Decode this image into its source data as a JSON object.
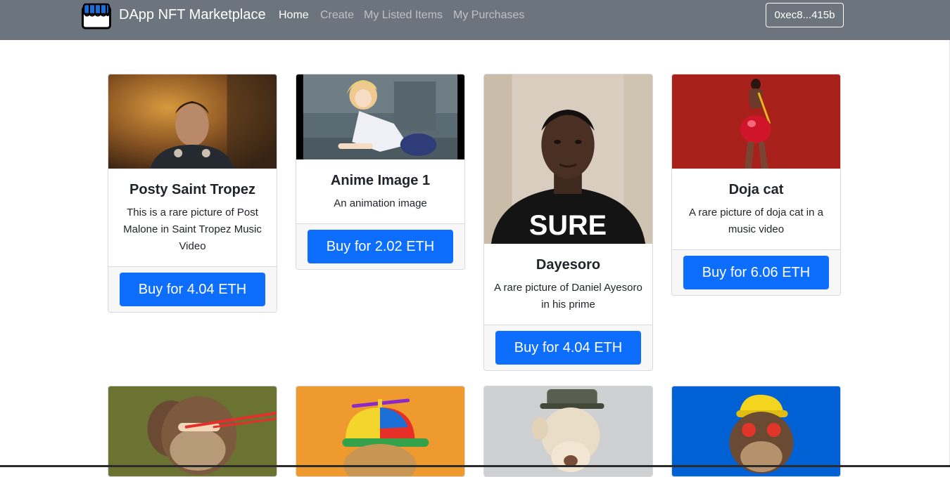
{
  "app": {
    "brand": "DApp NFT Marketplace",
    "nav": [
      {
        "label": "Home",
        "active": true
      },
      {
        "label": "Create",
        "active": false
      },
      {
        "label": "My Listed Items",
        "active": false
      },
      {
        "label": "My Purchases",
        "active": false
      }
    ],
    "account": "0xec8...415b"
  },
  "items": [
    {
      "name": "Posty Saint Tropez",
      "description": "This is a rare picture of Post Malone in Saint Tropez Music Video",
      "button": "Buy for 4.04 ETH",
      "image": "post-malone-photo"
    },
    {
      "name": "Anime Image 1",
      "description": "An animation image",
      "button": "Buy for 2.02 ETH",
      "image": "anime-girl-image"
    },
    {
      "name": "Dayesoro",
      "description": "A rare picture of Daniel Ayesoro in his prime",
      "button": "Buy for 4.04 ETH",
      "image": "man-selfie-photo"
    },
    {
      "name": "Doja cat",
      "description": "A rare picture of doja cat in a music video",
      "button": "Buy for 6.06 ETH",
      "image": "doja-cat-photo"
    },
    {
      "image": "laser-eyes-ape"
    },
    {
      "image": "propeller-hat-ape"
    },
    {
      "image": "army-cap-ape"
    },
    {
      "image": "yellow-hat-ape"
    }
  ],
  "colors": {
    "navbar": "#6c757d",
    "primary": "#0d6efd"
  }
}
